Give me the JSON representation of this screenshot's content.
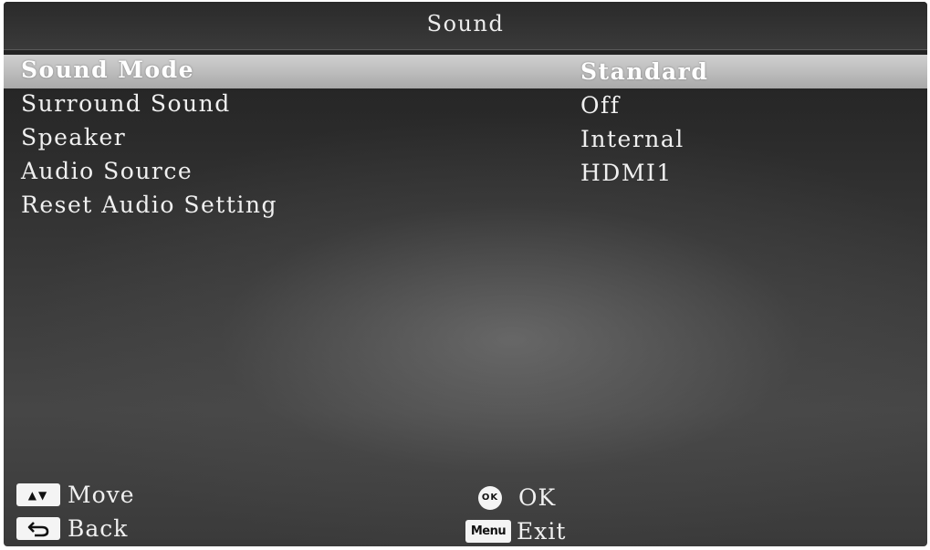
{
  "window": {
    "title": "Sound"
  },
  "menu": {
    "items": [
      {
        "label": "Sound Mode",
        "value": "Standard",
        "selected": true
      },
      {
        "label": "Surround Sound",
        "value": "Off",
        "selected": false
      },
      {
        "label": "Speaker",
        "value": "Internal",
        "selected": false
      },
      {
        "label": "Audio Source",
        "value": "HDMI1",
        "selected": false
      },
      {
        "label": "Reset Audio Setting",
        "value": "",
        "selected": false
      }
    ]
  },
  "footer": {
    "move_label": "Move",
    "back_label": "Back",
    "ok_label": "OK",
    "exit_label": "Exit",
    "arrows_glyph": "▲▼",
    "ok_glyph": "OK",
    "menu_key_text": "Menu"
  },
  "icons": {
    "move": "up-down-arrows-icon",
    "back": "return-arrow-icon",
    "ok": "ok-button-icon",
    "menu": "menu-key-icon"
  },
  "colors": {
    "highlight": "#c4c4c4",
    "text": "#f0f0f0",
    "background": "#333333"
  }
}
